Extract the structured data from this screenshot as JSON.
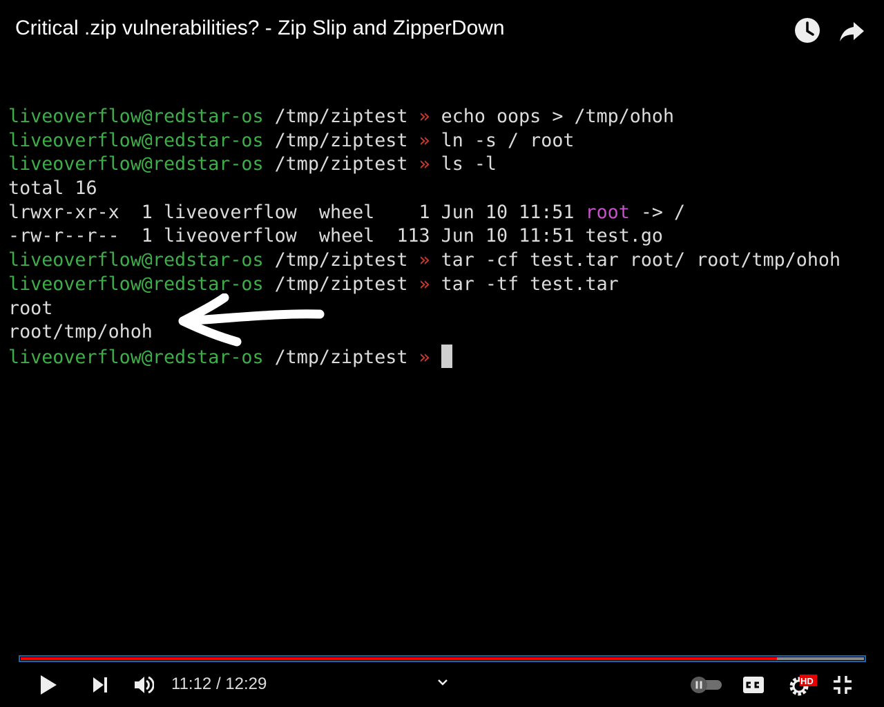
{
  "video": {
    "title": "Critical .zip vulnerabilities? - Zip Slip and ZipperDown",
    "top_icons": [
      "watch-later-icon",
      "share-icon"
    ]
  },
  "terminal": {
    "prompt_user": "liveoverflow@redstar-os",
    "prompt_path": "/tmp/ziptest",
    "prompt_symbol": "»",
    "lines": [
      {
        "type": "prompt",
        "cmd": "echo oops > /tmp/ohoh"
      },
      {
        "type": "prompt",
        "cmd": "ln -s / root"
      },
      {
        "type": "prompt",
        "cmd": "ls -l"
      },
      {
        "type": "out",
        "text": "total 16"
      },
      {
        "type": "ls",
        "pre": "lrwxr-xr-x  1 liveoverflow  wheel    1 Jun 10 11:51 ",
        "hl": "root",
        "post": " -> /"
      },
      {
        "type": "out",
        "text": "-rw-r--r--  1 liveoverflow  wheel  113 Jun 10 11:51 test.go"
      },
      {
        "type": "prompt",
        "cmd": "tar -cf test.tar root/ root/tmp/ohoh"
      },
      {
        "type": "prompt",
        "cmd": "tar -tf test.tar"
      },
      {
        "type": "out",
        "text": "root"
      },
      {
        "type": "out",
        "text": "root/tmp/ohoh"
      },
      {
        "type": "prompt",
        "cmd": "",
        "cursor": true
      }
    ]
  },
  "player": {
    "current_time": "11:12",
    "duration": "12:29",
    "time_display": "11:12 / 12:29",
    "progress_fraction": 0.897,
    "hd_badge": "HD",
    "colors": {
      "played": "#ff0000",
      "buffered": "#8a8a8a",
      "focus": "#1d64a8"
    }
  }
}
